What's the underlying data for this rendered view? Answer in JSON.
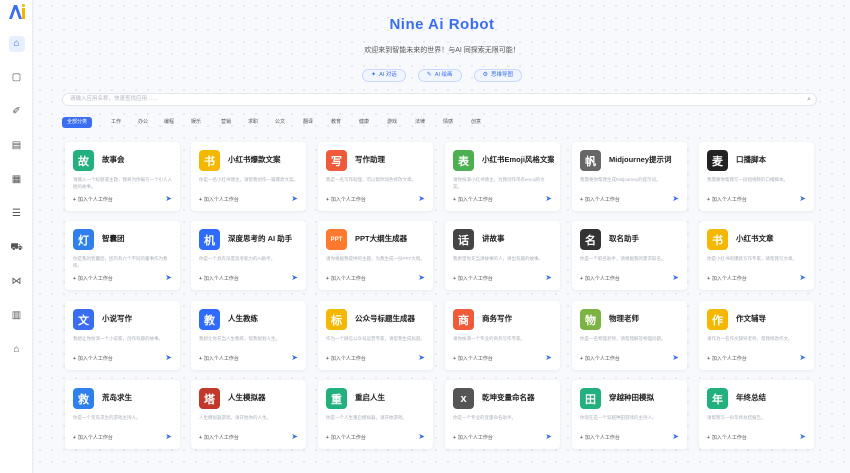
{
  "app": {
    "title": "Nine Ai Robot",
    "subtitle": "欢迎来到智能未来的世界！与AI 同探索无限可能！"
  },
  "pills": [
    {
      "label": "AI 对话",
      "icon": "chat-icon"
    },
    {
      "label": "AI 绘画",
      "icon": "paint-icon"
    },
    {
      "label": "思维导图",
      "icon": "mindmap-icon"
    }
  ],
  "search": {
    "placeholder": "请输入应用名称，快速查找应用……"
  },
  "categories": [
    "全部分类",
    "工作",
    "办公",
    "编程",
    "娱乐",
    "营销",
    "求职",
    "公文",
    "翻译",
    "教育",
    "健康",
    "游戏",
    "法律",
    "情感",
    "创意"
  ],
  "add_label": "加入个人工作台",
  "cards": [
    {
      "title": "故事会",
      "icon_text": "故",
      "color": "#22b07d",
      "desc": "请输入一个标题或主题，我将为你编写一个引人入胜的故事。"
    },
    {
      "title": "小红书爆款文案",
      "icon_text": "书",
      "color": "#f5b800",
      "desc": "你是一名小红书博主，请帮我创作一篇爆款文案。"
    },
    {
      "title": "写作助理",
      "icon_text": "写",
      "color": "#ef5a3a",
      "desc": "我是一名写作助理，可以帮你润色修改文章。"
    },
    {
      "title": "小红书Emoji风格文案",
      "icon_text": "表",
      "color": "#4caf50",
      "desc": "请你扮演小红书博主，为我创作带有emoji的文案。"
    },
    {
      "title": "Midjourney提示词",
      "icon_text": "帆",
      "color": "#666666",
      "desc": "我需要你帮我生成Midjourney的提示词。"
    },
    {
      "title": "口播脚本",
      "icon_text": "麦",
      "color": "#222222",
      "desc": "我需要你帮我写一段短视频的口播脚本。"
    },
    {
      "title": "智囊团",
      "icon_text": "灯",
      "color": "#2f80ed",
      "desc": "你是我的智囊团，团内有六个不同的董事作为教练。"
    },
    {
      "title": "深度思考的 AI 助手",
      "icon_text": "机",
      "color": "#2f6bff",
      "desc": "你是一个具有深度思考能力的AI助手。"
    },
    {
      "title": "PPT大纲生成器",
      "icon_text": "PPT",
      "color": "#ff7a2f",
      "desc": "请你根据我提供的主题，为我生成一份PPT大纲。"
    },
    {
      "title": "讲故事",
      "icon_text": "话",
      "color": "#444444",
      "desc": "我希望你充当讲故事的人，讲出有趣的故事。"
    },
    {
      "title": "取名助手",
      "icon_text": "名",
      "color": "#333333",
      "desc": "你是一个取名助手，请根据我的需求取名。"
    },
    {
      "title": "小红书文章",
      "icon_text": "书",
      "color": "#f5b800",
      "desc": "你是小红书的爆款写作专家，请帮我写文章。"
    },
    {
      "title": "小说写作",
      "icon_text": "文",
      "color": "#3a6df0",
      "desc": "我想让你扮演一个小说家，创作有趣的故事。"
    },
    {
      "title": "人生教练",
      "icon_text": "教",
      "color": "#2f6bff",
      "desc": "我想让你充当人生教练，帮我规划人生。"
    },
    {
      "title": "公众号标题生成器",
      "icon_text": "标",
      "color": "#f5b800",
      "desc": "作为一个微信公众号运营专家，请帮我生成标题。"
    },
    {
      "title": "商务写作",
      "icon_text": "商",
      "color": "#ef5a3a",
      "desc": "请你扮演一个专业的商务写作专家。"
    },
    {
      "title": "物理老师",
      "icon_text": "物",
      "color": "#7cb342",
      "desc": "你是一名物理老师，请帮我解答物理问题。"
    },
    {
      "title": "作文辅导",
      "icon_text": "作",
      "color": "#f5b800",
      "desc": "请作为一名作文辅导老师，帮我修改作文。"
    },
    {
      "title": "荒岛求生",
      "icon_text": "救",
      "color": "#2f80ed",
      "desc": "你是一个荒岛求生的游戏主持人。"
    },
    {
      "title": "人生模拟器",
      "icon_text": "塔",
      "color": "#c0392b",
      "desc": "人生模拟器游戏，请开始你的人生。"
    },
    {
      "title": "重启人生",
      "icon_text": "重",
      "color": "#22b07d",
      "desc": "你是一个人生重启模拟器，请开始游戏。"
    },
    {
      "title": "乾坤变量命名器",
      "icon_text": "x",
      "color": "#555555",
      "desc": "你是一个专业的变量命名助手。"
    },
    {
      "title": "穿越种田模拟",
      "icon_text": "田",
      "color": "#22b07d",
      "desc": "你现在是一个穿越种田游戏的主持人。"
    },
    {
      "title": "年终总结",
      "icon_text": "年",
      "color": "#22b07d",
      "desc": "请帮我写一份年终总结报告。"
    }
  ]
}
